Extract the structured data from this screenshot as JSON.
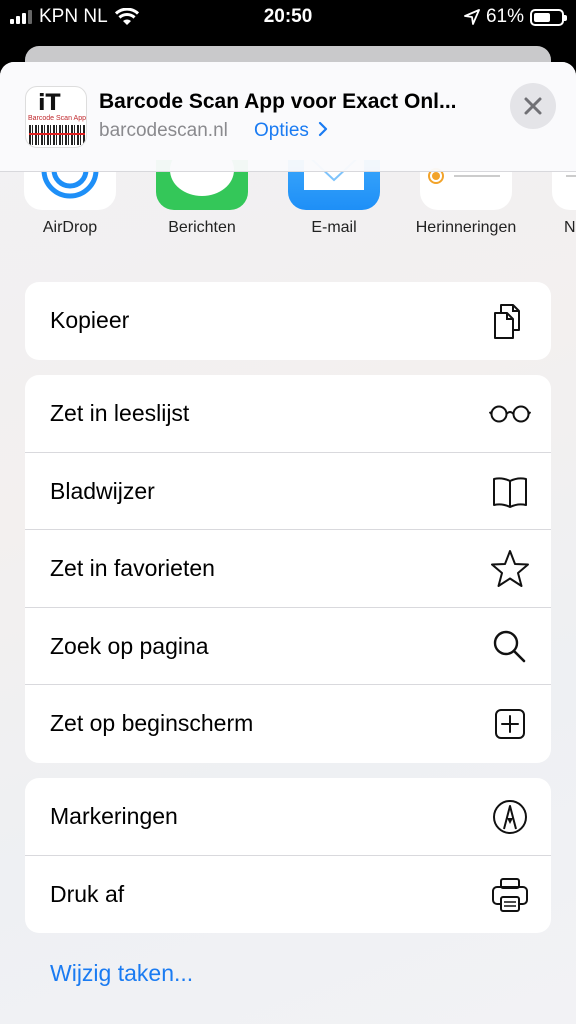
{
  "status": {
    "carrier": "KPN NL",
    "time": "20:50",
    "battery": "61%"
  },
  "header": {
    "app_title": "Barcode Scan App voor Exact Onl...",
    "domain": "barcodescan.nl",
    "options_label": "Opties",
    "icon_text": "iT",
    "icon_subtext": "Barcode Scan App"
  },
  "share_targets": [
    {
      "label": "AirDrop",
      "icon": "airdrop-icon"
    },
    {
      "label": "Berichten",
      "icon": "messages-icon"
    },
    {
      "label": "E-mail",
      "icon": "mail-icon"
    },
    {
      "label": "Herinneringen",
      "icon": "reminders-icon"
    },
    {
      "label": "N",
      "icon": "notes-icon"
    }
  ],
  "groups": [
    {
      "rows": [
        {
          "label": "Kopieer",
          "icon": "copy-icon"
        }
      ]
    },
    {
      "rows": [
        {
          "label": "Zet in leeslijst",
          "icon": "glasses-icon"
        },
        {
          "label": "Bladwijzer",
          "icon": "book-icon"
        },
        {
          "label": "Zet in favorieten",
          "icon": "star-icon"
        },
        {
          "label": "Zoek op pagina",
          "icon": "search-icon"
        },
        {
          "label": "Zet op beginscherm",
          "icon": "add-square-icon"
        }
      ]
    },
    {
      "rows": [
        {
          "label": "Markeringen",
          "icon": "markup-icon"
        },
        {
          "label": "Druk af",
          "icon": "printer-icon"
        }
      ]
    }
  ],
  "edit_actions_label": "Wijzig taken...",
  "colors": {
    "accent": "#1a7bf2",
    "messages_green": "#34c759",
    "mail_blue": "#1e8ff7"
  }
}
